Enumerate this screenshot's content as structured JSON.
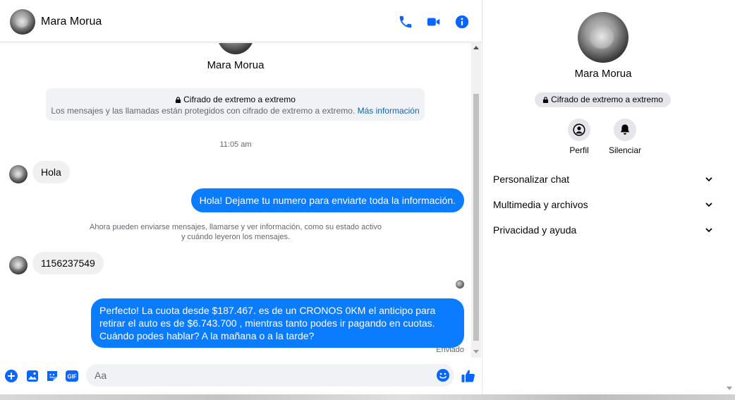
{
  "header": {
    "contact_name": "Mara Morua"
  },
  "conversation": {
    "contact_name": "Mara Morua",
    "e2e_title": "Cifrado de extremo a extremo",
    "e2e_subtitle": "Los mensajes y las llamadas están protegidos con cifrado de extremo a extremo.",
    "e2e_link": "Más información",
    "timestamp": "11:05 am",
    "messages": [
      {
        "from": "contact",
        "text": "Hola"
      },
      {
        "from": "me",
        "text": "Hola! Dejame tu numero  para enviarte toda la información."
      },
      {
        "from": "system",
        "line1": "Ahora pueden enviarse mensajes, llamarse y ver información, como su estado activo",
        "line2": "y cuándo leyeron los mensajes."
      },
      {
        "from": "contact",
        "text": "1156237549"
      },
      {
        "from": "me",
        "text": "Perfecto! La cuota desde $187.467. es de un CRONOS 0KM el anticipo para retirar el auto es de $6.743.700 , mientras tanto podes ir pagando en cuotas. Cuándo podes hablar? A la mañana o a la tarde?"
      }
    ],
    "sent_status": "Enviado"
  },
  "composer": {
    "placeholder": "Aa"
  },
  "sidebar": {
    "contact_name": "Mara Morua",
    "e2e_badge": "Cifrado de extremo a extremo",
    "actions": [
      {
        "label": "Perfil",
        "icon": "profile-icon"
      },
      {
        "label": "Silenciar",
        "icon": "bell-icon"
      }
    ],
    "sections": [
      {
        "label": "Personalizar chat"
      },
      {
        "label": "Multimedia y archivos"
      },
      {
        "label": "Privacidad y ayuda"
      }
    ]
  },
  "colors": {
    "accent": "#0a7cff",
    "icon_blue": "#0866ff",
    "link": "#0a66c2",
    "bubble_in": "#f0f0f0",
    "surface": "#f0f2f5"
  }
}
